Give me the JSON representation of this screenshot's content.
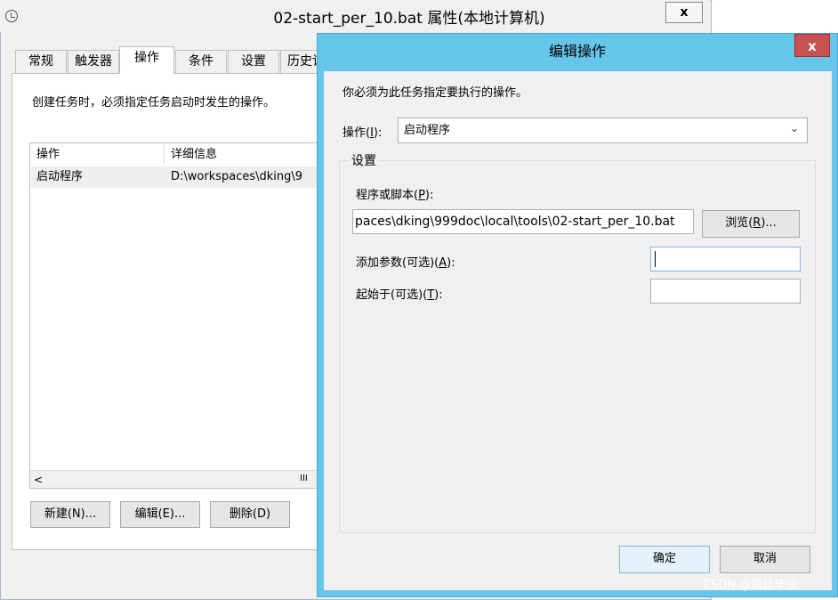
{
  "background_window": {
    "title": "02-start_per_10.bat 属性(本地计算机)",
    "close_label": "x",
    "tabs": [
      "常规",
      "触发器",
      "操作",
      "条件",
      "设置",
      "历史记"
    ],
    "active_tab": "操作",
    "description": "创建任务时，必须指定任务启动时发生的操作。",
    "list": {
      "columns": [
        "操作",
        "详细信息"
      ],
      "rows": [
        {
          "action": "启动程序",
          "details": "D:\\workspaces\\dking\\9"
        }
      ],
      "scroll_left": "<",
      "scroll_grip": "III"
    },
    "buttons": {
      "new": "新建(N)...",
      "edit": "编辑(E)...",
      "delete": "删除(D)"
    }
  },
  "dialog": {
    "title": "编辑操作",
    "close_label": "x",
    "prompt": "你必须为此任务指定要执行的操作。",
    "action_label_pre": "操作(",
    "action_label_key": "I",
    "action_label_post": "):",
    "action_value": "启动程序",
    "settings_legend": "设置",
    "program_label_pre": "程序或脚本(",
    "program_label_key": "P",
    "program_label_post": "):",
    "program_value": "paces\\dking\\999doc\\local\\tools\\02-start_per_10.bat",
    "browse_pre": "浏览(",
    "browse_key": "R",
    "browse_post": ")...",
    "args_label_pre": "添加参数(可选)(",
    "args_label_key": "A",
    "args_label_post": "):",
    "args_value": "",
    "start_label_pre": "起始于(可选)(",
    "start_label_key": "T",
    "start_label_post": "):",
    "start_value": "",
    "ok": "确定",
    "cancel": "取消"
  },
  "watermark": "CSDN @高廷毕设",
  "icons": {
    "window_icon": "clock-icon",
    "dropdown": "chevron-down-icon"
  },
  "colors": {
    "dialog_frame": "#66c6ea",
    "close_red": "#c75050",
    "selected_row": "#efefef"
  }
}
